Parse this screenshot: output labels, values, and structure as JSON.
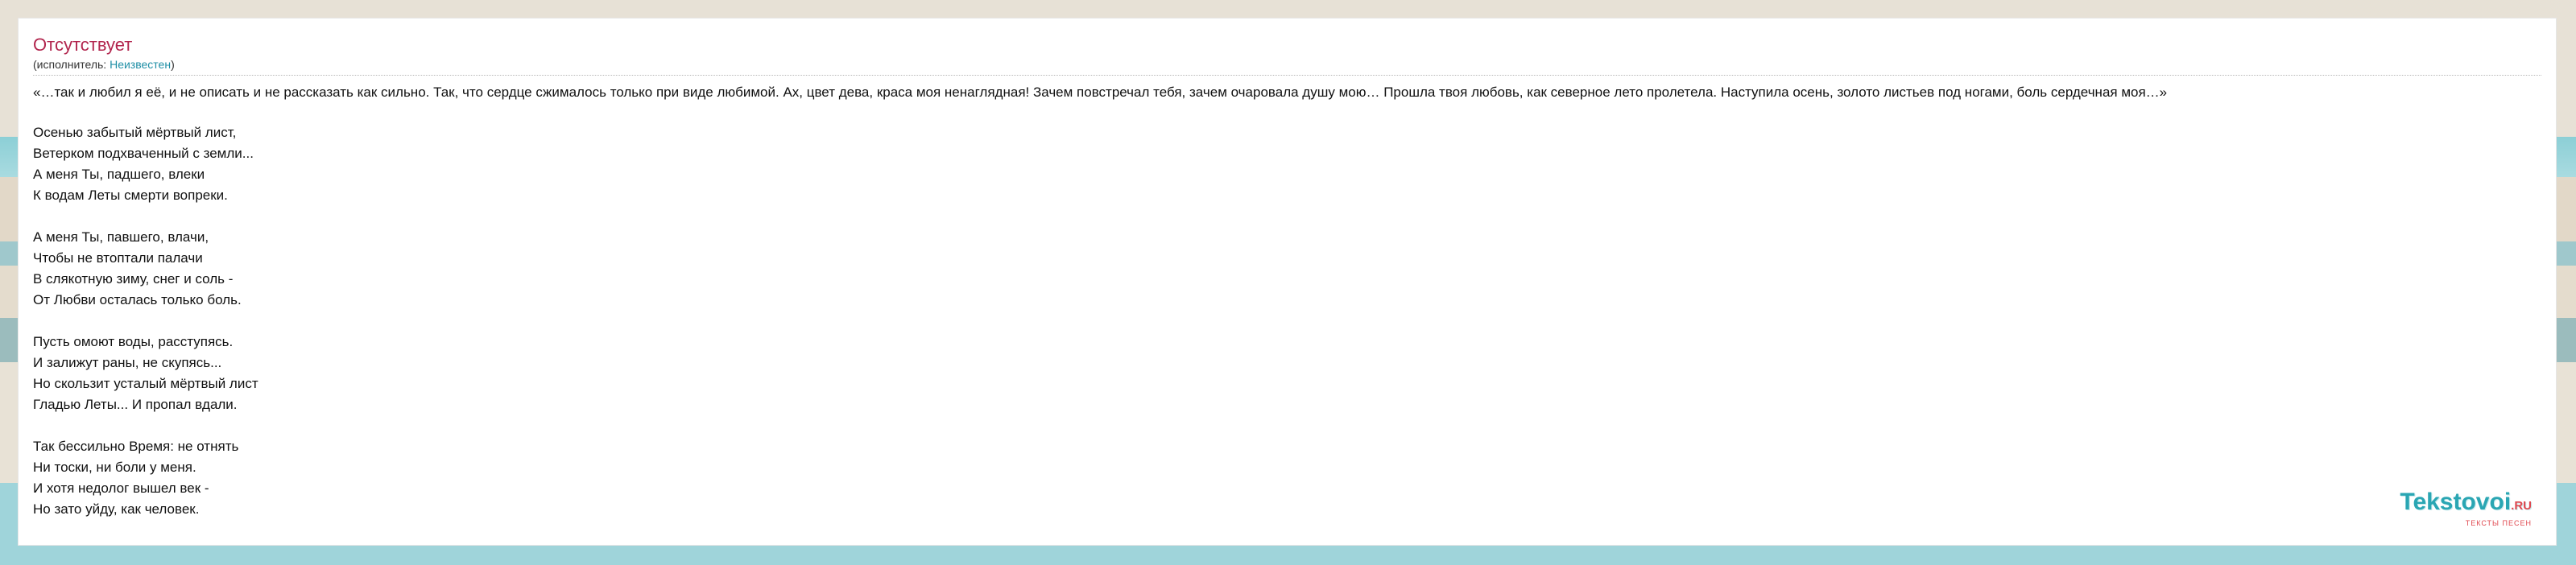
{
  "song": {
    "title": "Отсутствует",
    "performer_prefix": "(исполнитель: ",
    "performer_name": "Неизвестен",
    "performer_suffix": ")"
  },
  "intro": "«…так и любил я её, и не описать и не рассказать как сильно. Так, что сердце сжималось только при виде любимой. Ах, цвет дева, краса моя ненаглядная! Зачем повстречал тебя, зачем очаровала душу мою… Прошла твоя любовь, как северное лето пролетела. Наступила осень, золото листьев под ногами, боль сердечная моя…»",
  "stanzas": [
    [
      "Осенью забытый мёртвый лист,",
      "Ветерком подхваченный с земли...",
      "А меня Ты, падшего, влеки",
      "К водам Леты смерти вопреки."
    ],
    [
      "А меня Ты, павшего, влачи,",
      "Чтобы не втоптали палачи",
      "В слякотную зиму, снег и соль -",
      "От Любви осталась только боль."
    ],
    [
      "Пусть омоют воды, расступясь.",
      "И залижут раны, не скупясь...",
      "Но скользит усталый мёртвый лист",
      "Гладью Леты... И пропал вдали."
    ],
    [
      "Так бессильно Время: не отнять",
      "Ни тоски, ни боли у меня.",
      "И хотя недолог вышел век -",
      "Но зато уйду, как человек."
    ]
  ],
  "logo": {
    "name": "Tekstovoi",
    "tld": ".RU",
    "tagline": "ТЕКСТЫ ПЕСЕН"
  }
}
